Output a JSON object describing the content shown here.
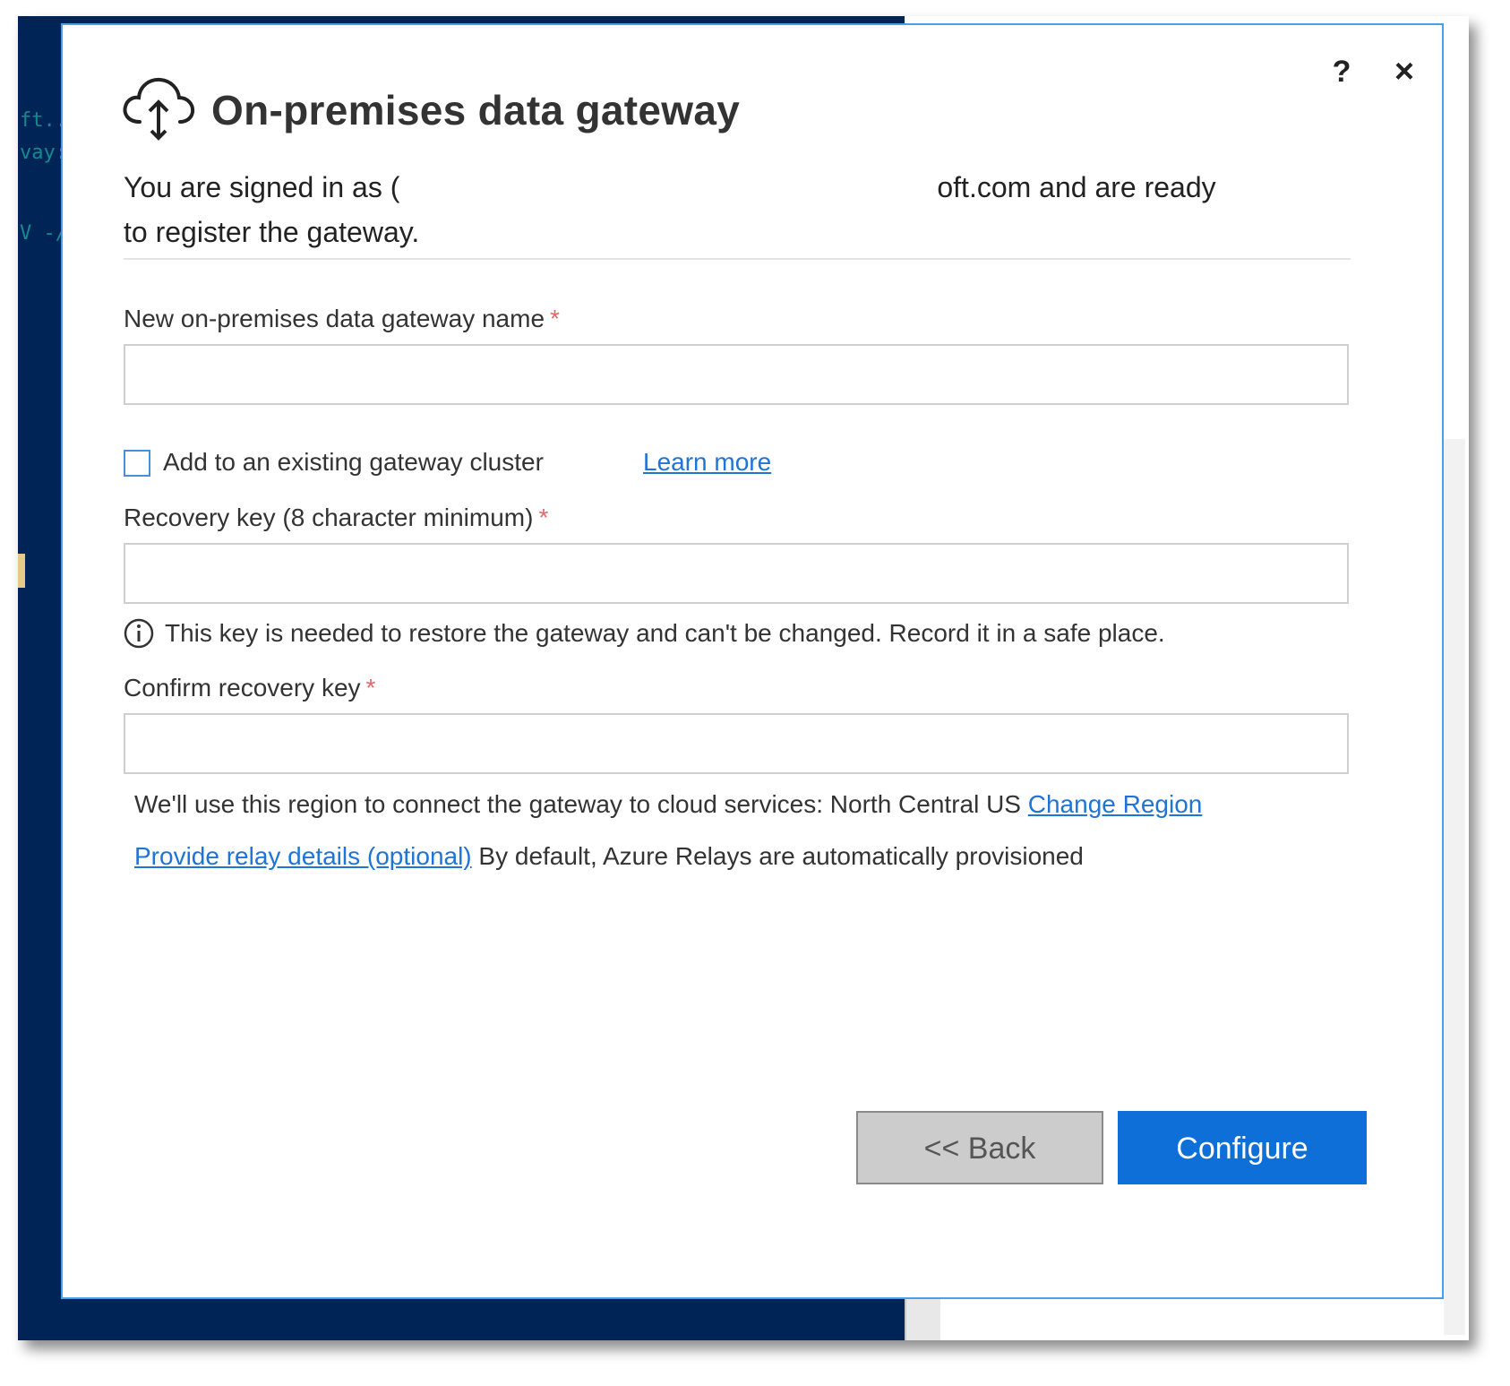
{
  "background": {
    "terminal_lines": [
      "ft..",
      "vay:",
      "V -/"
    ]
  },
  "dialog": {
    "help_label": "?",
    "close_label": "×",
    "title": "On-premises data gateway",
    "icon": "cloud-upload-icon",
    "signed_in_prefix": "You are signed in as (",
    "signed_in_suffix": "oft.com and are ready",
    "signed_in_line2": "to register the gateway.",
    "gateway_name_label": "New on-premises data gateway name",
    "gateway_name_value": "",
    "required_marker": "*",
    "add_cluster_label": "Add to an existing gateway cluster",
    "add_cluster_checked": false,
    "learn_more": "Learn more",
    "recovery_key_label": "Recovery key (8 character minimum)",
    "recovery_key_value": "",
    "info_text": "This key is needed to restore the gateway and can't be changed. Record it in a safe place.",
    "confirm_key_label": "Confirm recovery key",
    "confirm_key_value": "",
    "region_text": "We'll use this region to connect the gateway to cloud services: North Central US",
    "change_region": "Change Region",
    "relay_link": "Provide relay details (optional)",
    "relay_text": "By default, Azure Relays are automatically provisioned",
    "back_button": "<< Back",
    "configure_button": "Configure"
  },
  "colors": {
    "accent": "#0f6fd9",
    "terminal_bg": "#012456",
    "required": "#e06a6a"
  }
}
